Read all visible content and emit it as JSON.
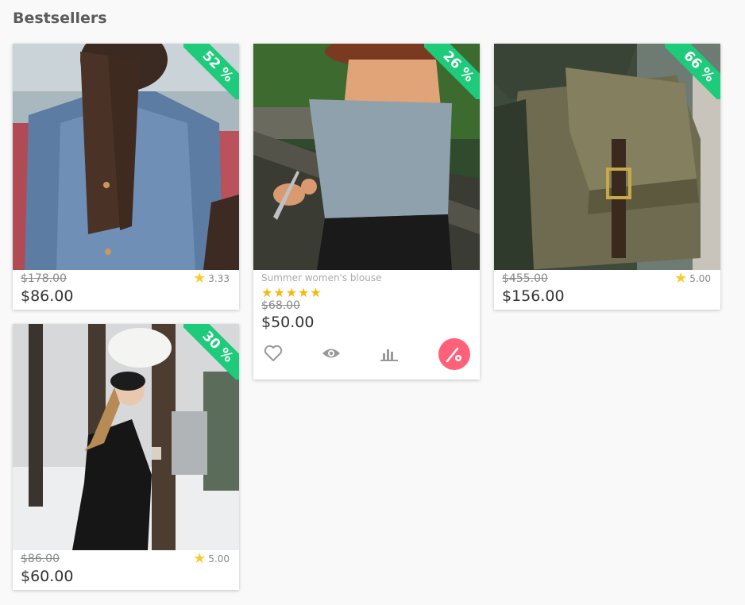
{
  "page": {
    "title": "Bestsellers"
  },
  "products": [
    {
      "discount": "52 %",
      "old_price": "$178.00",
      "price": "$86.00",
      "rating": "3.33"
    },
    {
      "discount": "26 %",
      "name": "Summer women's blouse",
      "stars": "★★★★★",
      "old_price": "$68.00",
      "price": "$50.00"
    },
    {
      "discount": "66 %",
      "old_price": "$455.00",
      "price": "$156.00",
      "rating": "5.00"
    },
    {
      "discount": "30 %",
      "old_price": "$86.00",
      "price": "$60.00",
      "rating": "5.00"
    }
  ],
  "actions": [
    "heart-icon",
    "eye-icon",
    "stats-icon",
    "settings-fab-icon"
  ],
  "colors": {
    "discount": "#1dcb7a",
    "fab": "#ff6179",
    "star": "#f5b90a",
    "background": "#f9f9f9"
  }
}
